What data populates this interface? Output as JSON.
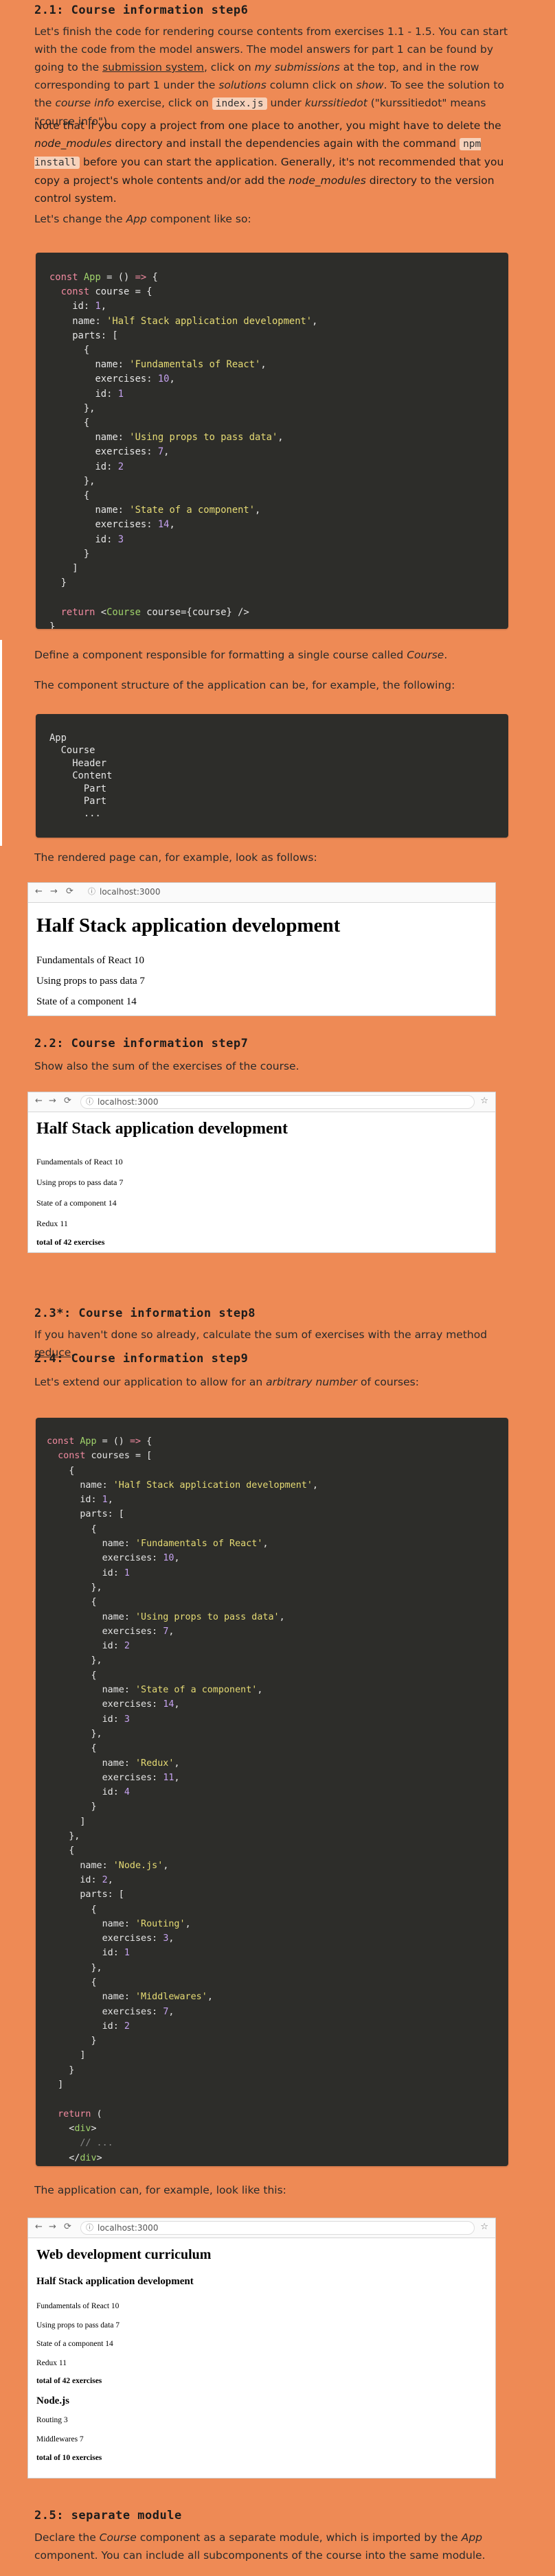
{
  "sections": {
    "step6_heading": "2.1: Course information step6",
    "step6_p1": "Let's finish the code for rendering course contents from exercises 1.1 - 1.5. You can start with the code from the model answers. The model answers for part 1 can be found by going to the submission system, click on my submissions at the top, and in the row corresponding to part 1 under the solutions column click on show. To see the solution to the course info exercise, click on index.js under kurssitiedot (\"kurssitiedot\" means \"course info\").",
    "step6_p2": "Note that if you copy a project from one place to another, you might have to delete the node_modules directory and install the dependencies again with the command npm install before you can start the application. Generally, it's not recommended that you copy a project's whole contents and/or add the node_modules directory to the version control system.",
    "step6_p3": "Let's change the App component like so:",
    "step6_p4": "Define a component responsible for formatting a single course called Course.",
    "step6_p5": "The component structure of the application can be, for example, the following:",
    "step6_p6": "The rendered page can, for example, look as follows:",
    "step7_heading": "2.2: Course information step7",
    "step7_p1": "Show also the sum of the exercises of the course.",
    "step8_heading": "2.3*: Course information step8",
    "step8_p1": "If you haven't done so already, calculate the sum of exercises with the array method reduce.",
    "step9_heading": "2.4: Course information step9",
    "step9_p1": "Let's extend our application to allow for an arbitrary number of courses:",
    "step9_p2": "The application can, for example, look like this:",
    "step10_heading": "2.5: separate module",
    "step10_p1": "Declare the Course component as a separate module, which is imported by the App component. You can include all subcomponents of the course into the same module."
  },
  "inline": {
    "submission_system": "submission system",
    "my_submissions": "my submissions",
    "solutions": "solutions",
    "show": "show",
    "index_js": "index.js",
    "kurssitiedot": "kurssitiedot",
    "node_modules": "node_modules",
    "npm_install": "npm install",
    "app": "App",
    "course": "Course",
    "reduce": "reduce",
    "arbitrary": "arbitrary number"
  },
  "tree": [
    "App",
    "Course",
    "Header",
    "Content",
    "Part",
    "Part",
    "..."
  ],
  "browser": {
    "url": "localhost:3000",
    "title": "Half Stack application development",
    "parts": [
      "Fundamentals of React 10",
      "Using props to pass data 7",
      "State of a component 14"
    ],
    "parts2": [
      "Fundamentals of React 10",
      "Using props to pass data 7",
      "State of a component 14",
      "Redux 11"
    ],
    "total1": "total of 42 exercises",
    "curriculum": "Web development curriculum",
    "course2_title": "Node.js",
    "course2_parts": [
      "Routing 3",
      "Middlewares 7"
    ],
    "total2": "total of 10 exercises"
  }
}
